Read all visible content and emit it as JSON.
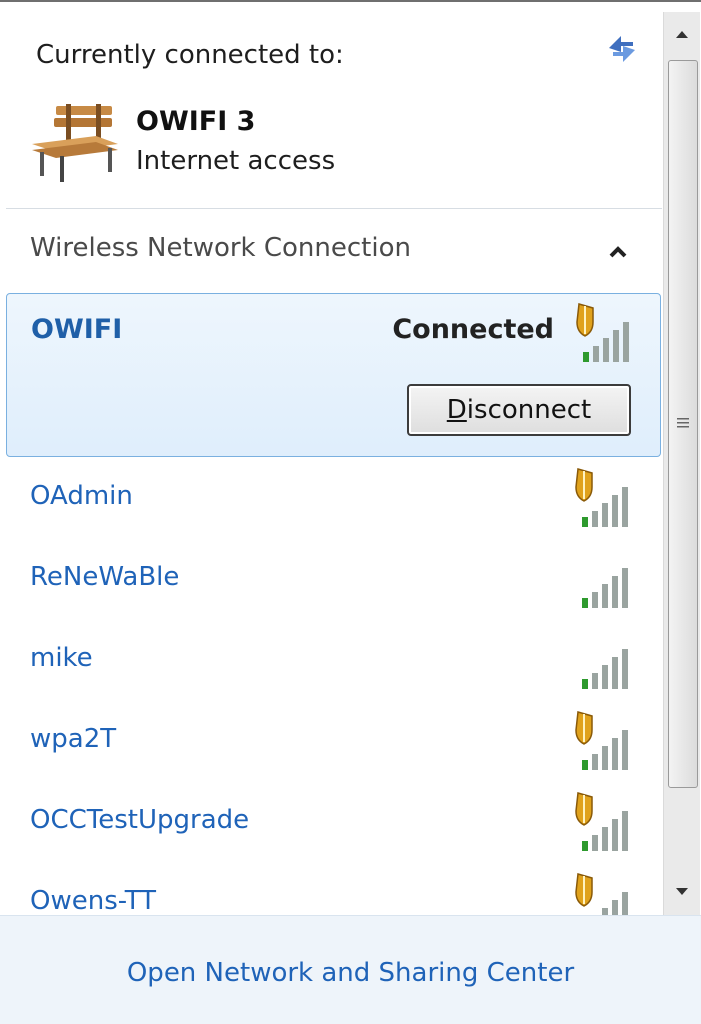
{
  "header": {
    "currently_connected_label": "Currently connected to:",
    "network_name": "OWIFI  3",
    "network_status": "Internet access"
  },
  "group": {
    "label": "Wireless Network Connection"
  },
  "selected": {
    "name": "OWIFI",
    "status": "Connected",
    "disconnect": {
      "mnemonic": "D",
      "rest": "isconnect"
    },
    "secured": true
  },
  "networks": [
    {
      "name": "OAdmin",
      "secured": true
    },
    {
      "name": "ReNeWaBle",
      "secured": false
    },
    {
      "name": "mike",
      "secured": false
    },
    {
      "name": "wpa2T",
      "secured": true
    },
    {
      "name": "OCCTestUpgrade",
      "secured": true
    },
    {
      "name": "Owens-TT",
      "secured": true
    }
  ],
  "footer": {
    "link": "Open Network and Sharing Center"
  },
  "colors": {
    "link_blue": "#1f63b8",
    "selected_name": "#1f5fa8",
    "signal_green": "#2e9a2e",
    "shield_gold": "#e0a21c"
  }
}
